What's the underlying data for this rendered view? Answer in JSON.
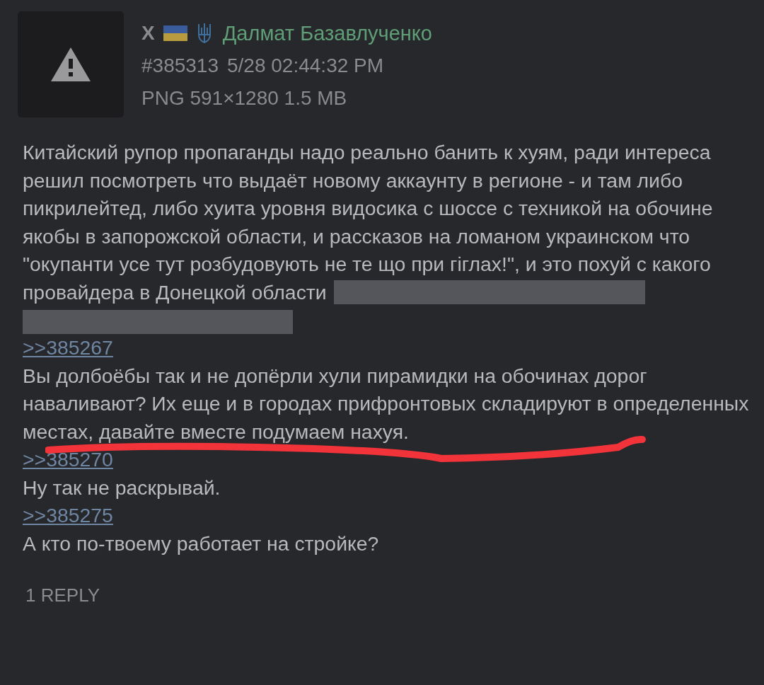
{
  "post": {
    "flag_label": "X",
    "name": "Далмат Базавлученко",
    "number": "#385313",
    "timestamp": "5/28 02:44:32 PM",
    "file_info": "PNG 591×1280 1.5 MB"
  },
  "body": [
    {
      "kind": "text",
      "text": "Китайский рупор пропаганды надо реально банить к хуям, ради интереса решил посмотреть что выдаёт новому аккаунту в регионе - и там либо пикрилейтед, либо хуита уровня видосика с шоссе с техникой на обочине якобы в запорожской области, и рассказов на ломаном украинском что \"окупанти усе тут розбудовують не те що при гіглах!\", и это похуй с какого"
    },
    {
      "kind": "text",
      "text": "провайдера в Донецкой области",
      "spoilers": [
        {
          "kind": "spoiler"
        },
        {
          "kind": "spoiler"
        }
      ]
    },
    {
      "kind": "quote",
      "text": ">>385267"
    },
    {
      "kind": "text",
      "text": "Вы долбоёбы так и не допёрли хули пирамидки на обочинах дорог наваливают? Их еще и в городах прифронтовых складируют в определенных местах, давайте вместе подумаем нахуя."
    },
    {
      "kind": "quote",
      "text": ">>385270"
    },
    {
      "kind": "text",
      "text": "Ну так не раскрывай."
    },
    {
      "kind": "quote",
      "text": ">>385275"
    },
    {
      "kind": "text",
      "text": "А кто по-твоему работает на стройке?"
    }
  ],
  "replies": "1 REPLY"
}
